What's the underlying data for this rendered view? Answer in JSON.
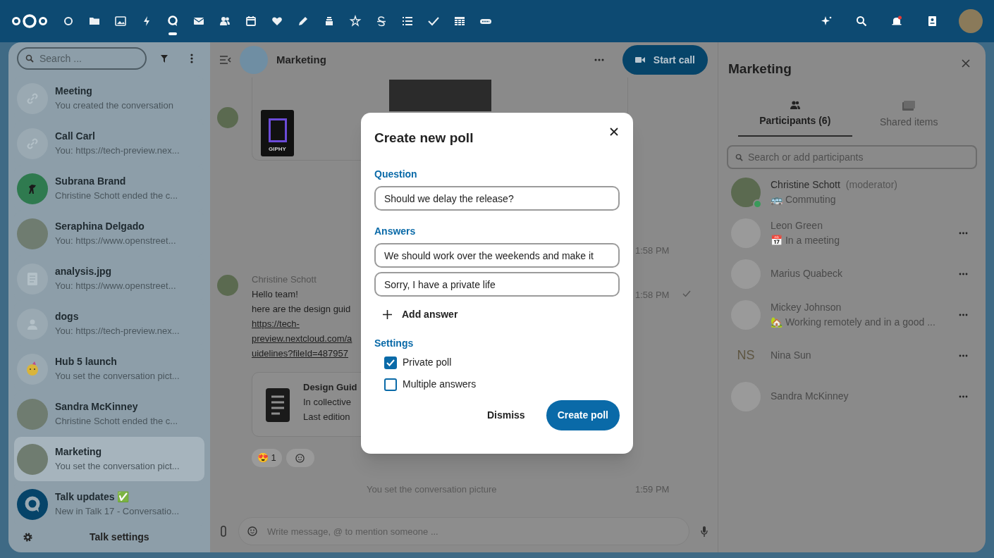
{
  "top_bar": {
    "apps": [
      {
        "kind": "circle",
        "selected": false
      },
      {
        "kind": "folder",
        "selected": false
      },
      {
        "kind": "image",
        "selected": false
      },
      {
        "kind": "bolt",
        "selected": false
      },
      {
        "kind": "talk",
        "selected": true
      },
      {
        "kind": "mail",
        "selected": false
      },
      {
        "kind": "contacts",
        "selected": false
      },
      {
        "kind": "calendar",
        "selected": false
      },
      {
        "kind": "heart",
        "selected": false
      },
      {
        "kind": "pencil",
        "selected": false
      },
      {
        "kind": "deck",
        "selected": false
      },
      {
        "kind": "star",
        "selected": false
      },
      {
        "kind": "strike",
        "selected": false
      },
      {
        "kind": "list",
        "selected": false
      },
      {
        "kind": "check",
        "selected": false
      },
      {
        "kind": "table",
        "selected": false
      },
      {
        "kind": "badge",
        "selected": false
      }
    ],
    "right_icons": [
      {
        "kind": "sparkle"
      },
      {
        "kind": "search"
      },
      {
        "kind": "bell"
      },
      {
        "kind": "contacts-card"
      },
      {
        "kind": "avatar"
      }
    ]
  },
  "conversations": {
    "search": {
      "placeholder": "Search ..."
    },
    "items": [
      {
        "name": "Meeting",
        "preview": "You created the conversation",
        "kind": "link",
        "selected": false
      },
      {
        "name": "Call Carl",
        "preview": "You: https://tech-preview.nex...",
        "kind": "link",
        "selected": false
      },
      {
        "name": "Subrana Brand",
        "preview": "Christine Schott ended the c...",
        "kind": "logo",
        "selected": false
      },
      {
        "name": "Seraphina Delgado",
        "preview": "You: https://www.openstreet...",
        "kind": "photo",
        "selected": false
      },
      {
        "name": "analysis.jpg",
        "preview": "You: https://www.openstreet...",
        "kind": "file",
        "selected": false
      },
      {
        "name": "dogs",
        "preview": "You: https://tech-preview.nex...",
        "kind": "person",
        "selected": false
      },
      {
        "name": "Hub 5 launch",
        "preview": "You set the conversation pict...",
        "kind": "emoji",
        "selected": false
      },
      {
        "name": "Sandra McKinney",
        "preview": "Christine Schott ended the c...",
        "kind": "photo",
        "selected": false
      },
      {
        "name": "Marketing",
        "preview": "You set the conversation pict...",
        "kind": "photo",
        "selected": true
      },
      {
        "name": "Talk updates ✅",
        "preview": "New in Talk 17 - Conversatio...",
        "kind": "talk",
        "selected": false
      }
    ],
    "settings": "Talk settings"
  },
  "chat": {
    "title": "Marketing",
    "start_call": "Start call",
    "gif_label": "GIPHY",
    "times": [
      "1:58 PM",
      "1:58 PM"
    ],
    "message": {
      "author": "Christine Schott",
      "lines": [
        "Hello team!",
        "here are the design guid"
      ],
      "link": [
        "https://tech-",
        "preview.nextcloud.com/a",
        "uidelines?fileId=487957"
      ]
    },
    "file_card": {
      "title": "Design Guid",
      "lines": [
        "In collective",
        "Last edition"
      ]
    },
    "reactions": [
      {
        "emoji": "😍",
        "count": "1"
      }
    ],
    "system": {
      "text": "You set the conversation picture",
      "time": "1:59 PM"
    },
    "composer": {
      "placeholder": "Write message, @ to mention someone ..."
    }
  },
  "dialog": {
    "title": "Create new poll",
    "question_label": "Question",
    "question": "Should we delay the release?",
    "answers_label": "Answers",
    "answers": [
      "We should work over the weekends and make it",
      "Sorry, I have a private life"
    ],
    "add_answer": "Add answer",
    "settings_label": "Settings",
    "settings": [
      {
        "label": "Private poll",
        "checked": true
      },
      {
        "label": "Multiple answers",
        "checked": false
      }
    ],
    "buttons": [
      "Dismiss",
      "Create poll"
    ]
  },
  "details": {
    "title": "Marketing",
    "tabs": [
      {
        "label": "Participants (6)",
        "selected": true
      },
      {
        "label": "Shared items",
        "selected": false
      }
    ],
    "search": {
      "placeholder": "Search or add participants"
    },
    "participants": [
      {
        "name": "Christine Schott",
        "role": "(moderator)",
        "status_emoji": "🚌",
        "status": "Commuting",
        "online": true,
        "kind": "photo"
      },
      {
        "name": "Leon Green",
        "status_emoji": "📅",
        "status": "In a meeting",
        "online": false,
        "kind": "photo"
      },
      {
        "name": "Marius Quabeck",
        "online": false,
        "kind": "photo"
      },
      {
        "name": "Mickey Johnson",
        "status_emoji": "🏡",
        "status": "Working remotely and in a good ...",
        "online": false,
        "kind": "photo"
      },
      {
        "name": "Nina Sun",
        "initials": "NS",
        "online": false,
        "kind": "initials"
      },
      {
        "name": "Sandra McKinney",
        "online": false,
        "kind": "photo"
      }
    ]
  }
}
